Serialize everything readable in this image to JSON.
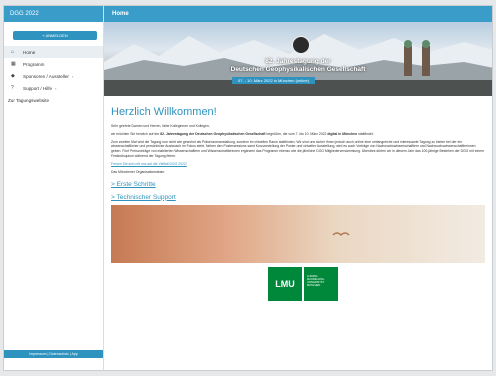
{
  "sidebar": {
    "title": "DGG 2022",
    "login_label": "+ ANMELDEN",
    "items": [
      {
        "label": "Home",
        "icon": "home-icon",
        "glyph": "⌂",
        "active": true,
        "chevron": ""
      },
      {
        "label": "Programm",
        "icon": "calendar-icon",
        "glyph": "▦",
        "active": false,
        "chevron": ""
      },
      {
        "label": "Sponsoren / Aussteller",
        "icon": "handshake-icon",
        "glyph": "◆",
        "active": false,
        "chevron": "›"
      },
      {
        "label": "Support / Hilfe",
        "icon": "question-icon",
        "glyph": "?",
        "active": false,
        "chevron": "›"
      },
      {
        "label": "Zur Tagungswebsite",
        "icon": "",
        "glyph": "",
        "active": false,
        "chevron": ""
      }
    ],
    "footer": "Impressum | Datenschutz | App"
  },
  "header": {
    "title": "Home"
  },
  "banner": {
    "title_line1": "82. Jahrestagung der",
    "title_line2": "Deutschen Geophysikalischen Gesellschaft",
    "date": "07. - 10. März 2022 in München (online)"
  },
  "main": {
    "welcome": "Herzlich Willkommen!",
    "p1": "Sehr geehrte Damen und Herren, liebe Kolleginnen und Kollegen,",
    "p2_a": "wir möchten Sie herzlich auf der ",
    "p2_b": "82. Jahrestagung der Deutschen Geophysikalischen Gesellschaft",
    "p2_c": " begrüßen, die vom 7. bis 10. März 2022 ",
    "p2_d": "digital in München",
    "p2_e": " stattfindet.",
    "p3": "Zum zweiten Mal wird die Tagung nun nicht wie gewohnt als Präsenzveranstaltung, sondern im virtuellen Raum stattfinden. Wir sind uns sicher Ihnen jedoch auch online eine umfangreiche und interessante Tagung zu bieten bei der ein wissenschaftlicher und persönlicher Austausch im Fokus steht. Neben den Postersessions samt Kurzvorstellung der Poster und virtueller Ausstellung, wird es auch Vorträge von Nachwuchswissenschaftlern und Nachwuchswissenschaftlerinnen geben. Fünf Preisvorträge von etablierten Wissenschaftlern und Wissenschaftlerinnen ergänzen das Programm ebenso wie die jährliche DGG Mitgliederversammlung. Überdies dürfen wir in diesem Jahr das 100-jährige Bestehen der DGG mit einem Festkolloquium während der Tagung feiern.",
    "link_small": "Freuen Sie sich mit uns auf die Vielfalt DGG 2022!",
    "closing": "Das Münchener Organisationsteam",
    "link_first_steps": "> Erste Schritte",
    "link_support": "> Technischer Support",
    "lmu_logo_text": "LMU",
    "lmu_name": "LUDWIG-MAXIMILIANS-UNIVERSITÄT MÜNCHEN"
  },
  "colors": {
    "accent": "#3a9cc8",
    "lmu_green": "#00883a"
  }
}
